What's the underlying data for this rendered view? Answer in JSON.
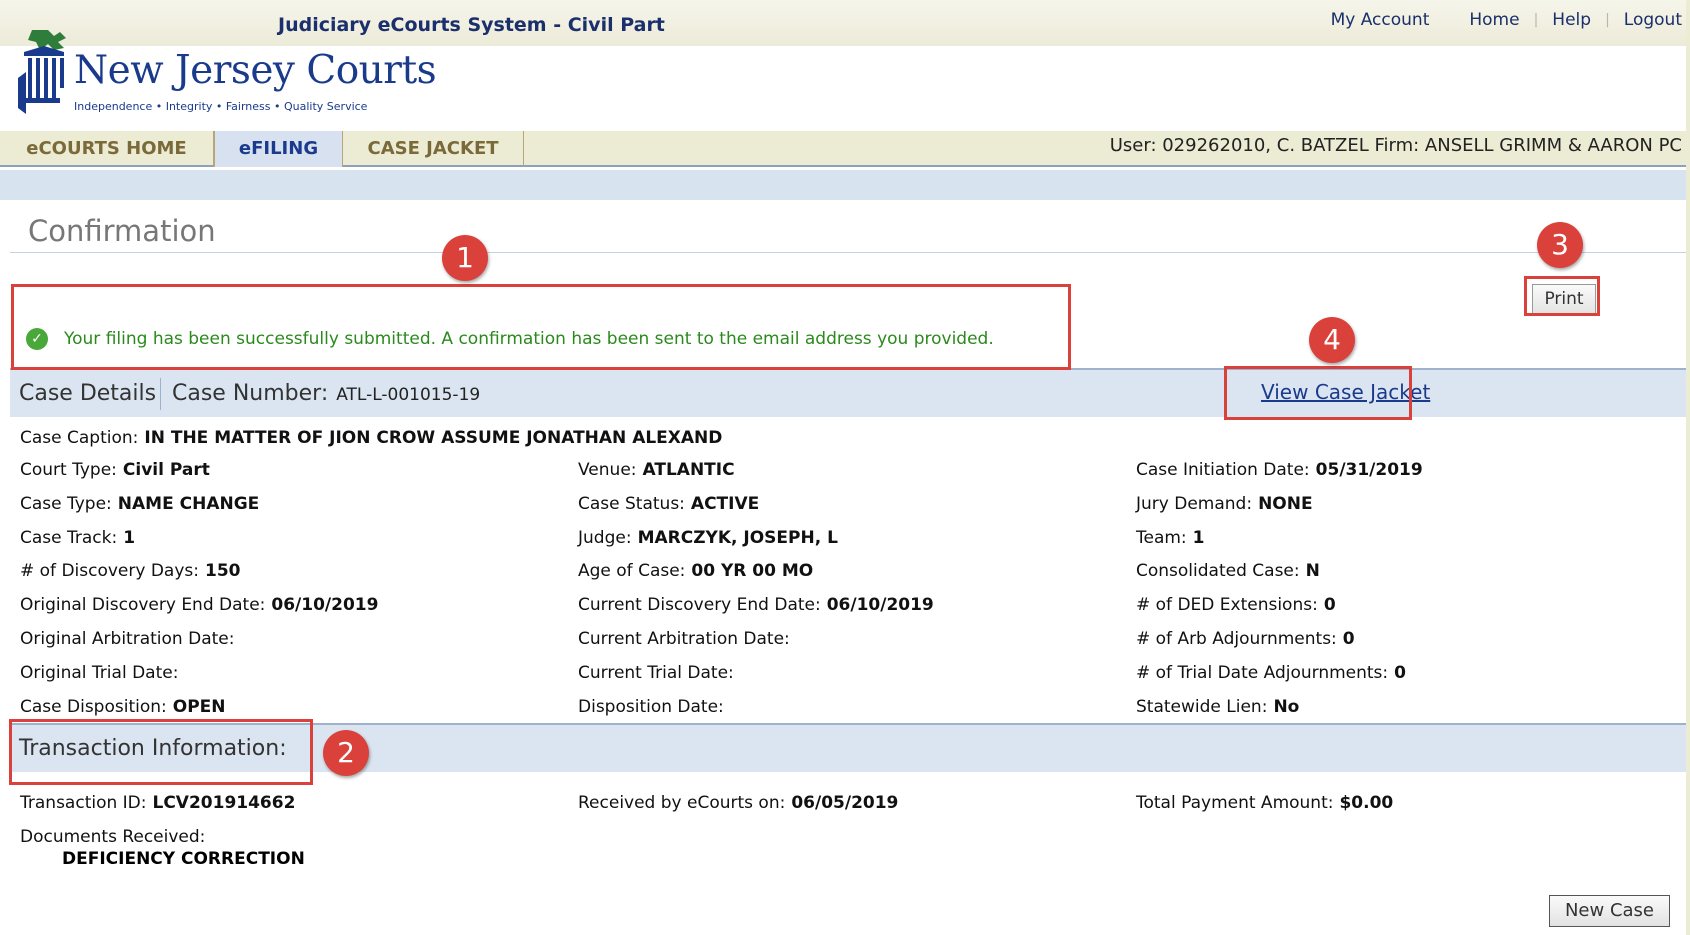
{
  "header": {
    "system_title": "Judiciary eCourts System - Civil Part",
    "links": [
      "My Account",
      "Home",
      "Help",
      "Logout"
    ],
    "logo_text": "New Jersey Courts",
    "logo_tagline": "Independence • Integrity • Fairness • Quality Service"
  },
  "nav": {
    "tabs": [
      "eCOURTS HOME",
      "eFILING",
      "CASE JACKET"
    ],
    "active_tab": "eFILING",
    "user_info": "User: 029262010, C. BATZEL  Firm: ANSELL GRIMM & AARON PC"
  },
  "page": {
    "title": "Confirmation",
    "print_label": "Print",
    "success_message": "Your filing has been successfully submitted. A confirmation has been sent to the email address you provided."
  },
  "case_header": {
    "label": "Case Details",
    "number_label": "Case Number:",
    "number_value": "ATL-L-001015-19",
    "view_link": "View Case Jacket"
  },
  "case_caption": {
    "label": "Case Caption:",
    "value": "IN THE MATTER OF JION CROW ASSUME JONATHAN ALEXAND"
  },
  "details": {
    "col1": [
      {
        "label": "Court Type:",
        "value": "Civil Part"
      },
      {
        "label": "Case Type:",
        "value": "NAME CHANGE"
      },
      {
        "label": "Case Track:",
        "value": "1"
      },
      {
        "label": "# of Discovery Days:",
        "value": "150"
      },
      {
        "label": "Original Discovery End Date:",
        "value": "06/10/2019"
      },
      {
        "label": "Original Arbitration Date:",
        "value": ""
      },
      {
        "label": "Original Trial Date:",
        "value": ""
      },
      {
        "label": "Case Disposition:",
        "value": "OPEN"
      }
    ],
    "col2": [
      {
        "label": "Venue:",
        "value": "ATLANTIC"
      },
      {
        "label": "Case Status:",
        "value": "ACTIVE"
      },
      {
        "label": "Judge:",
        "value": "MARCZYK, JOSEPH, L"
      },
      {
        "label": "Age of Case:",
        "value": "00 YR 00 MO"
      },
      {
        "label": "Current Discovery End Date:",
        "value": "06/10/2019"
      },
      {
        "label": "Current Arbitration Date:",
        "value": ""
      },
      {
        "label": "Current Trial Date:",
        "value": ""
      },
      {
        "label": "Disposition Date:",
        "value": ""
      }
    ],
    "col3": [
      {
        "label": "Case Initiation Date:",
        "value": "05/31/2019"
      },
      {
        "label": "Jury Demand:",
        "value": "NONE"
      },
      {
        "label": "Team:",
        "value": "1"
      },
      {
        "label": "Consolidated Case:",
        "value": "N"
      },
      {
        "label": "# of DED Extensions:",
        "value": "0"
      },
      {
        "label": "# of Arb Adjournments:",
        "value": "0"
      },
      {
        "label": "# of Trial Date Adjournments:",
        "value": "0"
      },
      {
        "label": "Statewide Lien:",
        "value": "No"
      }
    ]
  },
  "transaction": {
    "header": "Transaction Information:",
    "id_label": "Transaction ID:",
    "id_value": "LCV201914662",
    "received_label": "Received by eCourts on:",
    "received_value": "06/05/2019",
    "payment_label": "Total Payment Amount:",
    "payment_value": "$0.00",
    "documents_label": "Documents Received:",
    "documents_item": "DEFICIENCY CORRECTION"
  },
  "new_case_label": "New Case",
  "annotations": [
    "1",
    "2",
    "3",
    "4"
  ],
  "colors": {
    "annotation_red": "#d9413a",
    "link_blue": "#1a3a8c",
    "success_green": "#2a8a1c",
    "section_bg": "#dbe5f1"
  }
}
